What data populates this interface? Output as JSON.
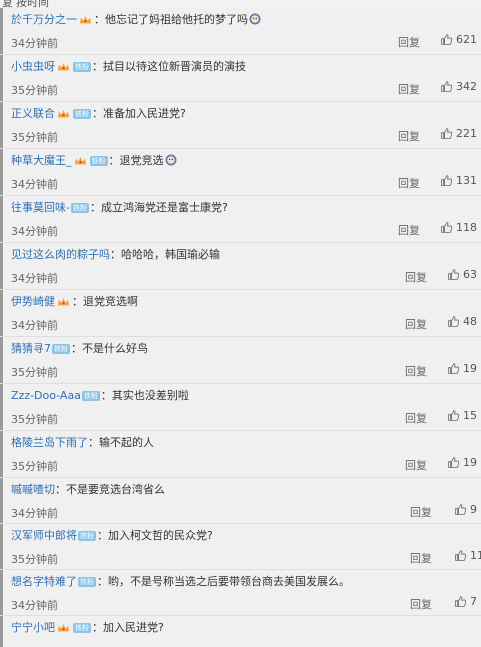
{
  "header": {
    "left_text": "复",
    "right_text": "按时间"
  },
  "reply_label": "回复",
  "fan_badge_label": "铁粉",
  "comments": [
    {
      "name": "於千万分之一",
      "crown": true,
      "fan": false,
      "text": "他忘记了妈祖给他托的梦了吗",
      "emoji": true,
      "time": "34分钟前",
      "likes": "621"
    },
    {
      "name": "小虫虫呀",
      "crown": true,
      "fan": true,
      "text": "拭目以待这位新晋演员的演技",
      "emoji": false,
      "time": "35分钟前",
      "likes": "342"
    },
    {
      "name": "正义联合",
      "crown": true,
      "fan": true,
      "text": "准备加入民进党?",
      "emoji": false,
      "time": "35分钟前",
      "likes": "221"
    },
    {
      "name": "种草大魔王_",
      "crown": true,
      "fan": true,
      "text": "退党竞选",
      "emoji": true,
      "time": "34分钟前",
      "likes": "131"
    },
    {
      "name": "往事莫回味-",
      "crown": false,
      "fan": true,
      "text": "成立鸿海党还是富士康党?",
      "emoji": false,
      "time": "34分钟前",
      "likes": "118"
    },
    {
      "name": "见过这么肉的粽子吗",
      "crown": false,
      "fan": false,
      "text": "哈哈哈，韩国瑜必输",
      "emoji": false,
      "time": "34分钟前",
      "likes": "63"
    },
    {
      "name": "伊势崎健",
      "crown": true,
      "fan": false,
      "text": "退党竞选啊",
      "emoji": false,
      "time": "34分钟前",
      "likes": "48"
    },
    {
      "name": "猜猜寻7",
      "crown": false,
      "fan": true,
      "text": "不是什么好鸟",
      "emoji": false,
      "time": "35分钟前",
      "likes": "19"
    },
    {
      "name": "Zzz-Doo-Aaa",
      "crown": false,
      "fan": true,
      "text": "其实也没差别啦",
      "emoji": false,
      "time": "35分钟前",
      "likes": "15"
    },
    {
      "name": "格陵兰岛下雨了",
      "crown": false,
      "fan": false,
      "text": "输不起的人",
      "emoji": false,
      "time": "35分钟前",
      "likes": "19"
    },
    {
      "name": "嘁嘁喳切",
      "crown": false,
      "fan": false,
      "text": "不是要竞选台湾省么",
      "emoji": false,
      "time": "34分钟前",
      "likes": "9"
    },
    {
      "name": "汉军师中郎将",
      "crown": false,
      "fan": true,
      "text": "加入柯文哲的民众党?",
      "emoji": false,
      "time": "35分钟前",
      "likes": "11"
    },
    {
      "name": "想名字特难了",
      "crown": false,
      "fan": true,
      "text": "哟，不是号称当选之后要带领台商去美国发展么。",
      "emoji": false,
      "time": "34分钟前",
      "likes": "7"
    },
    {
      "name": "宁宁小吧",
      "crown": true,
      "fan": true,
      "text": "加入民进党?",
      "emoji": false,
      "time": "",
      "likes": ""
    }
  ]
}
